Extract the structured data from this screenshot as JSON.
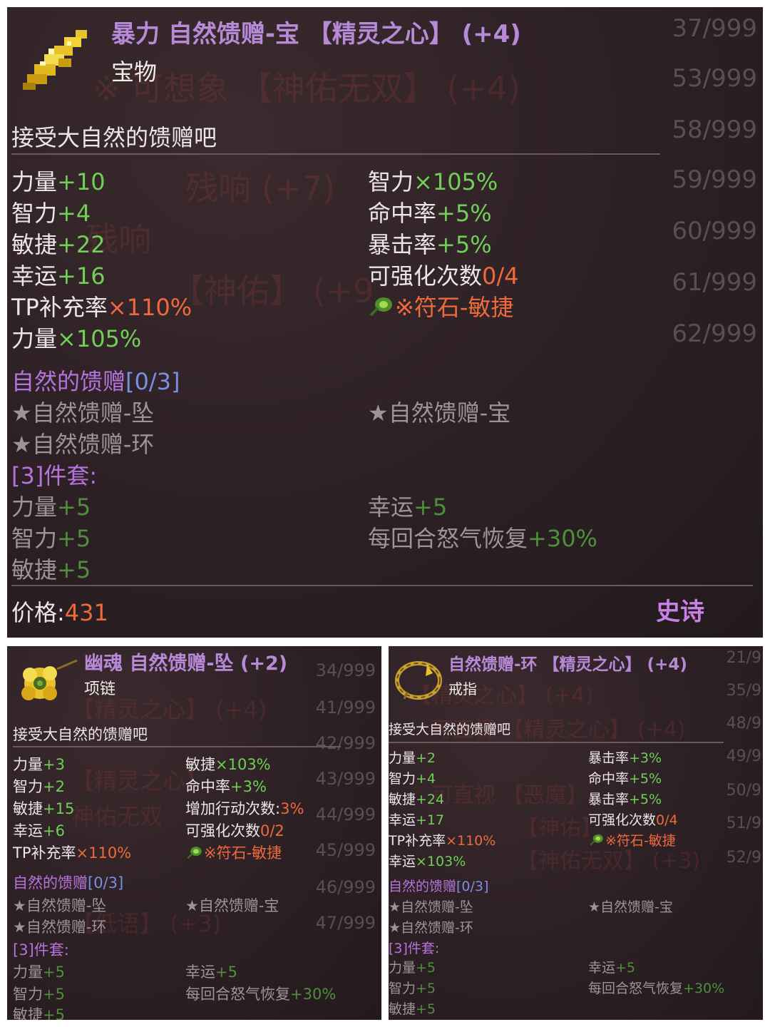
{
  "panels": [
    {
      "title": "暴力 自然馈赠-宝 【精灵之心】 (+4)",
      "type": "宝物",
      "description": "接受大自然的馈赠吧",
      "icon": "golden-branch-icon",
      "stats_left": [
        {
          "name": "力量",
          "value": "+10"
        },
        {
          "name": "智力",
          "value": "+4"
        },
        {
          "name": "敏捷",
          "value": "+22"
        },
        {
          "name": "幸运",
          "value": "+16"
        },
        {
          "name": "TP补充率",
          "value": "×110%"
        },
        {
          "name": "力量",
          "value": "×105%"
        }
      ],
      "stats_right": [
        {
          "name": "智力",
          "value": "×105%"
        },
        {
          "name": "命中率",
          "value": "+5%"
        },
        {
          "name": "暴击率",
          "value": "+5%"
        },
        {
          "name": "可强化次数",
          "value": "0/4"
        }
      ],
      "rune": "※符石-敏捷",
      "set_name": "自然的馈赠",
      "set_count": "[0/3]",
      "set_items": [
        "★自然馈赠-坠",
        "★自然馈赠-宝",
        "★自然馈赠-环"
      ],
      "set_bonus_label": "[3]件套:",
      "set_bonus_left": [
        {
          "name": "力量",
          "value": "+5"
        },
        {
          "name": "智力",
          "value": "+5"
        },
        {
          "name": "敏捷",
          "value": "+5"
        }
      ],
      "set_bonus_right": [
        {
          "name": "幸运",
          "value": "+5"
        },
        {
          "name": "每回合怒气恢复",
          "value": "+30%"
        }
      ],
      "price_label": "价格:",
      "price_value": "431",
      "rarity": "史诗",
      "bg_counts": [
        "37/999",
        "53/999",
        "58/999",
        "59/999",
        "60/999",
        "61/999",
        "62/999"
      ],
      "bg_text": [
        "※ 可想象 【神佑无双】 (+4)",
        "残响 (+7)",
        "残响",
        "【神佑】 (+9"
      ]
    },
    {
      "title": "幽魂 自然馈赠-坠 (+2)",
      "type": "项链",
      "description": "接受大自然的馈赠吧",
      "icon": "golden-flower-icon",
      "stats_left": [
        {
          "name": "力量",
          "value": "+3"
        },
        {
          "name": "智力",
          "value": "+2"
        },
        {
          "name": "敏捷",
          "value": "+15"
        },
        {
          "name": "幸运",
          "value": "+6"
        },
        {
          "name": "TP补充率",
          "value": "×110%"
        }
      ],
      "stats_right": [
        {
          "name": "敏捷",
          "value": "×103%"
        },
        {
          "name": "命中率",
          "value": "+3%"
        },
        {
          "name": "增加行动次数:",
          "value": "3%"
        },
        {
          "name": "可强化次数",
          "value": "0/2"
        }
      ],
      "rune": "※符石-敏捷",
      "set_name": "自然的馈赠",
      "set_count": "[0/3]",
      "set_items": [
        "★自然馈赠-坠",
        "★自然馈赠-宝",
        "★自然馈赠-环"
      ],
      "set_bonus_label": "[3]件套:",
      "set_bonus_left": [
        {
          "name": "力量",
          "value": "+5"
        },
        {
          "name": "智力",
          "value": "+5"
        },
        {
          "name": "敏捷",
          "value": "+5"
        }
      ],
      "set_bonus_right": [
        {
          "name": "幸运",
          "value": "+5"
        },
        {
          "name": "每回合怒气恢复",
          "value": "+30%"
        }
      ],
      "bg_counts": [
        "34/999",
        "41/999",
        "42/999",
        "43/999",
        "44/999",
        "45/999",
        "46/999",
        "47/999"
      ],
      "bg_text": [
        "【精灵之心】 (+4)",
        "【精灵之心】",
        "神佑无双",
        "【低语】 (+3)"
      ]
    },
    {
      "title": "自然馈赠-环 【精灵之心】 (+4)",
      "type": "戒指",
      "description": "接受大自然的馈赠吧",
      "icon": "vine-ring-icon",
      "stats_left": [
        {
          "name": "力量",
          "value": "+2"
        },
        {
          "name": "智力",
          "value": "+4"
        },
        {
          "name": "敏捷",
          "value": "+24"
        },
        {
          "name": "幸运",
          "value": "+17"
        },
        {
          "name": "TP补充率",
          "value": "×110%"
        },
        {
          "name": "幸运",
          "value": "×103%"
        }
      ],
      "stats_right": [
        {
          "name": "暴击率",
          "value": "+3%"
        },
        {
          "name": "命中率",
          "value": "+5%"
        },
        {
          "name": "暴击率",
          "value": "+5%"
        },
        {
          "name": "可强化次数",
          "value": "0/4"
        }
      ],
      "rune": "※符石-敏捷",
      "set_name": "自然的馈赠",
      "set_count": "[0/3]",
      "set_items": [
        "★自然馈赠-坠",
        "★自然馈赠-宝",
        "★自然馈赠-环"
      ],
      "set_bonus_label": "[3]件套:",
      "set_bonus_left": [
        {
          "name": "力量",
          "value": "+5"
        },
        {
          "name": "智力",
          "value": "+5"
        },
        {
          "name": "敏捷",
          "value": "+5"
        }
      ],
      "set_bonus_right": [
        {
          "name": "幸运",
          "value": "+5"
        },
        {
          "name": "每回合怒气恢复",
          "value": "+30%"
        }
      ],
      "bg_counts": [
        "21/9",
        "35/9",
        "48/9",
        "49/9",
        "50/9",
        "51/9",
        "52/9"
      ],
      "bg_text": [
        "【精灵之心】 (+4)",
        "可直视 【精灵之心】 (+4)",
        "可直视 【恶魔】",
        "【神佑】",
        "【神佑无双】 (+3)"
      ]
    }
  ],
  "colors": {
    "title": "#b78ad8",
    "green": "#6fcf56",
    "orange": "#ee6a3c",
    "set": "#b673dc",
    "set_count": "#7a8fe0",
    "rarity": "#c880e6",
    "price": "#ee6a3c"
  }
}
